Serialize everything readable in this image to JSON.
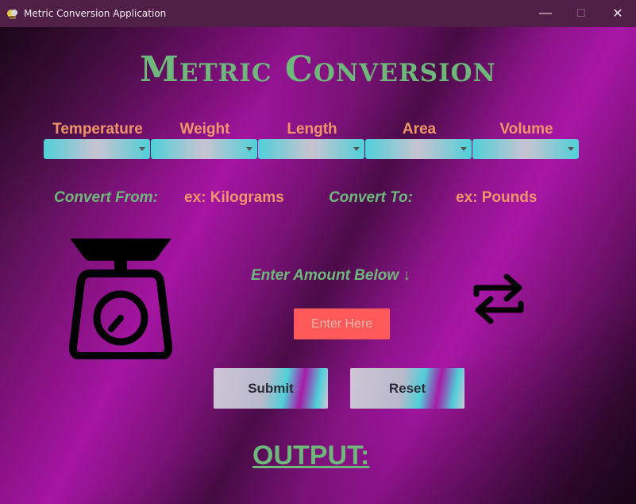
{
  "window": {
    "title": "Metric Conversion Application",
    "controls": {
      "minimize": "—",
      "maximize": "☐",
      "close": "✕"
    }
  },
  "heading": "Metric Conversion",
  "categories": [
    {
      "label": "Temperature",
      "selected": ""
    },
    {
      "label": "Weight",
      "selected": ""
    },
    {
      "label": "Length",
      "selected": ""
    },
    {
      "label": "Area",
      "selected": ""
    },
    {
      "label": "Volume",
      "selected": ""
    }
  ],
  "convert": {
    "from_label": "Convert From:",
    "from_value": "ex: Kilograms",
    "to_label": "Convert To:",
    "to_value": "ex: Pounds"
  },
  "amount": {
    "label": "Enter Amount Below ↓",
    "placeholder": "Enter Here",
    "value": ""
  },
  "buttons": {
    "submit": "Submit",
    "reset": "Reset"
  },
  "output_label": "OUTPUT: ",
  "icons": [
    "app-icon",
    "scale-icon",
    "swap-arrows-icon",
    "dropdown-arrow-icon"
  ],
  "colors": {
    "heading_green": "#6fb87b",
    "label_orange": "#f0956a",
    "input_red": "#ff5a5a",
    "dropdown_teal": "#4fd0d8",
    "background_magenta": "#a515a2",
    "titlebar": "#4f1f48"
  }
}
